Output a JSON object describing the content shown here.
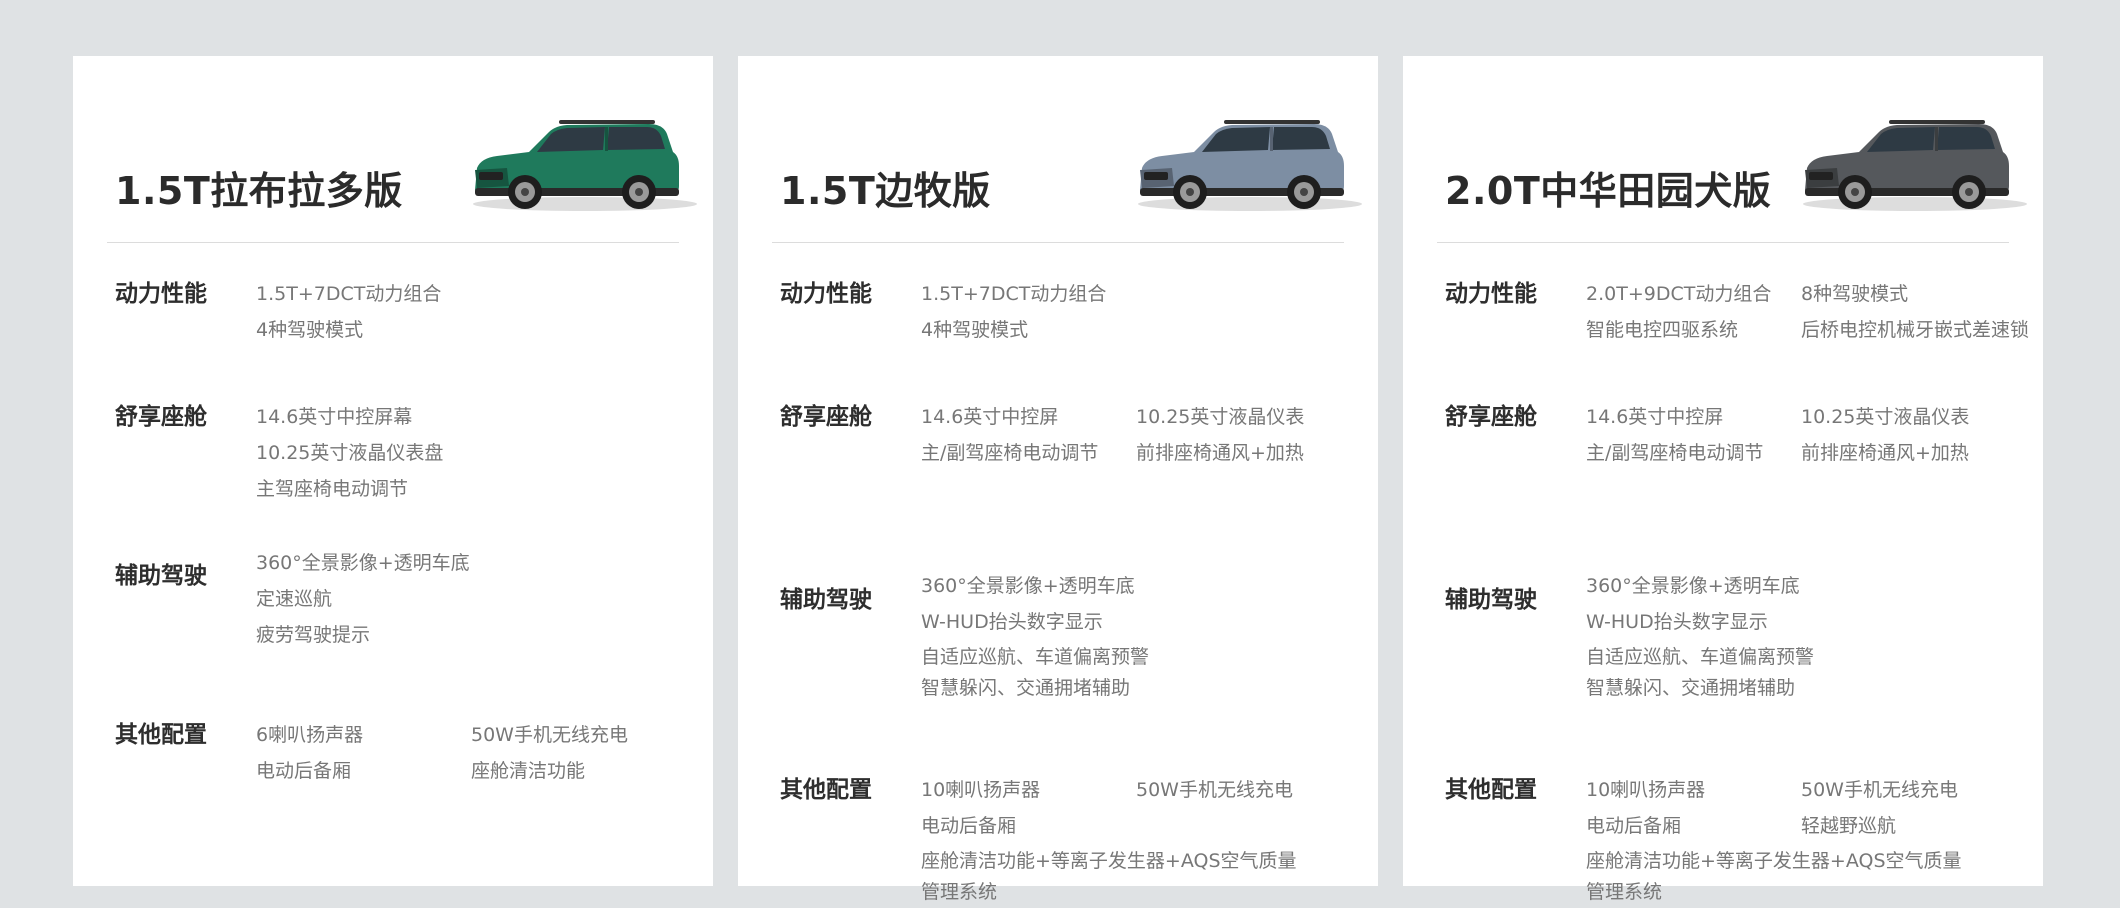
{
  "cards": [
    {
      "title": "1.5T拉布拉多版",
      "car_color": "#1f7a5c",
      "sections": [
        {
          "title": "动力性能",
          "items": [
            "1.5T+7DCT动力组合",
            "4种驾驶模式"
          ]
        },
        {
          "title": "舒享座舱",
          "items": [
            "14.6英寸中控屏幕",
            "10.25英寸液晶仪表盘",
            "主驾座椅电动调节"
          ]
        },
        {
          "title": "辅助驾驶",
          "items": [
            "360°全景影像+透明车底",
            "定速巡航",
            "疲劳驾驶提示"
          ]
        },
        {
          "title": "其他配置",
          "items": [
            "6喇叭扬声器",
            "50W手机无线充电",
            "电动后备厢",
            "座舱清洁功能"
          ]
        }
      ]
    },
    {
      "title": "1.5T边牧版",
      "car_color": "#7d8ea3",
      "sections": [
        {
          "title": "动力性能",
          "items": [
            "1.5T+7DCT动力组合",
            "4种驾驶模式"
          ]
        },
        {
          "title": "舒享座舱",
          "items": [
            "14.6英寸中控屏",
            "10.25英寸液晶仪表",
            "主/副驾座椅电动调节",
            "前排座椅通风+加热"
          ]
        },
        {
          "title": "辅助驾驶",
          "items": [
            "360°全景影像+透明车底",
            "W-HUD抬头数字显示",
            "自适应巡航、车道偏离预警",
            "智慧躲闪、交通拥堵辅助"
          ]
        },
        {
          "title": "其他配置",
          "items": [
            "10喇叭扬声器",
            "50W手机无线充电",
            "电动后备厢",
            "座舱清洁功能+等离子发生器+AQS空气质量管理系统"
          ]
        }
      ]
    },
    {
      "title": "2.0T中华田园犬版",
      "car_color": "#55585c",
      "sections": [
        {
          "title": "动力性能",
          "items": [
            "2.0T+9DCT动力组合",
            "8种驾驶模式",
            "智能电控四驱系统",
            "后桥电控机械牙嵌式差速锁"
          ]
        },
        {
          "title": "舒享座舱",
          "items": [
            "14.6英寸中控屏",
            "10.25英寸液晶仪表",
            "主/副驾座椅电动调节",
            "前排座椅通风+加热"
          ]
        },
        {
          "title": "辅助驾驶",
          "items": [
            "360°全景影像+透明车底",
            "W-HUD抬头数字显示",
            "自适应巡航、车道偏离预警",
            "智慧躲闪、交通拥堵辅助"
          ]
        },
        {
          "title": "其他配置",
          "items": [
            "10喇叭扬声器",
            "50W手机无线充电",
            "电动后备厢",
            "轻越野巡航",
            "座舱清洁功能+等离子发生器+AQS空气质量管理系统"
          ]
        }
      ]
    }
  ]
}
